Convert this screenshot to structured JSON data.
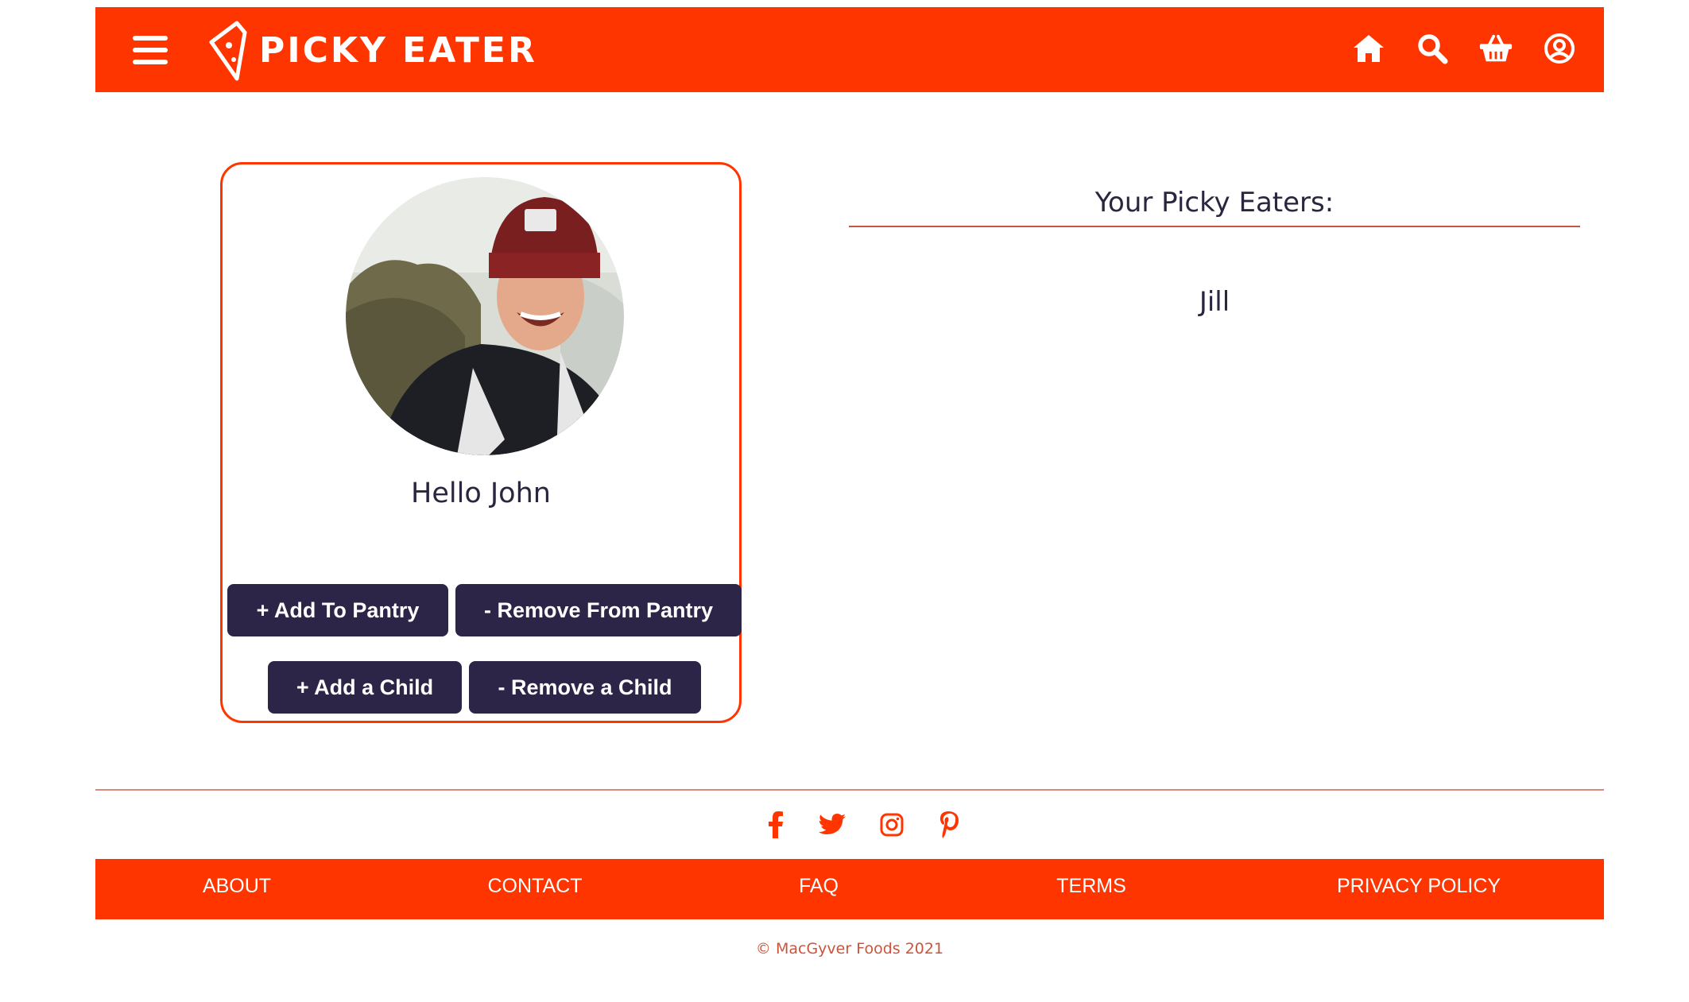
{
  "header": {
    "brand": "PICKY EATER",
    "menu_icon": "hamburger-menu-icon",
    "nav_icons": [
      "home-icon",
      "search-icon",
      "basket-icon",
      "user-circle-icon"
    ]
  },
  "profile": {
    "greeting": "Hello John",
    "avatar": "profile-photo",
    "buttons": {
      "add_pantry": "+ Add To Pantry",
      "remove_pantry": "- Remove From Pantry",
      "add_child": "+ Add a Child",
      "remove_child": "- Remove a Child"
    }
  },
  "eaters": {
    "title": "Your Picky Eaters:",
    "items": [
      "Jill"
    ]
  },
  "footer": {
    "social_icons": [
      "facebook-icon",
      "twitter-icon",
      "instagram-icon",
      "pinterest-icon"
    ],
    "links": [
      "ABOUT",
      "CONTACT",
      "FAQ",
      "TERMS",
      "PRIVACY POLICY"
    ],
    "copyright": "© MacGyver Foods 2021"
  },
  "colors": {
    "brand_orange": "#ff3500",
    "button_navy": "#2c2547",
    "text_dark": "#2b2640",
    "copyright_text": "#c8553d"
  }
}
